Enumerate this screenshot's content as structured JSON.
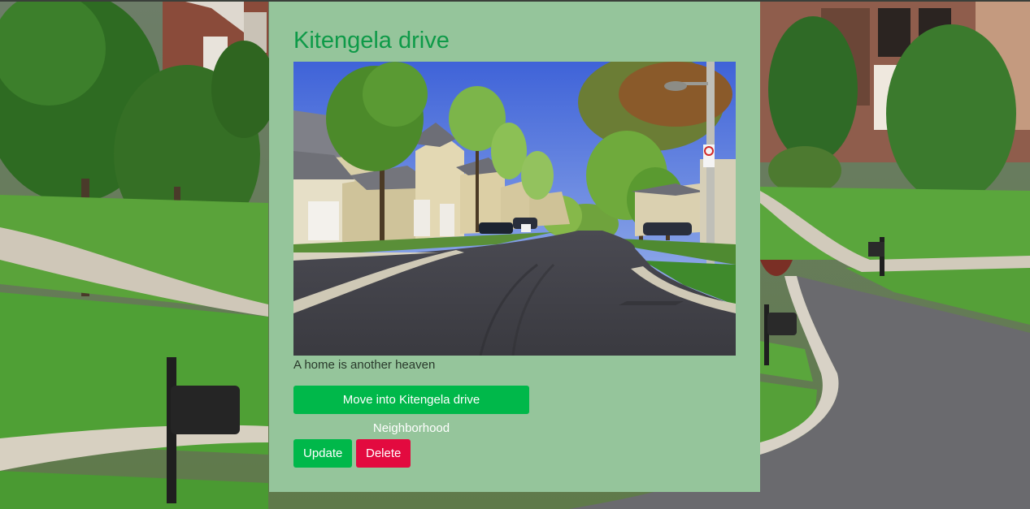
{
  "neighborhood": {
    "name": "Kitengela drive",
    "description": "A home is another heaven",
    "image_alt": "Suburban street with houses and trees"
  },
  "actions": {
    "move_label": "Move into Kitengela drive Neighborhood",
    "update_label": "Update",
    "delete_label": "Delete"
  },
  "colors": {
    "card_background": "#95c59b",
    "title": "#0e9a48",
    "primary_button": "#00b84a",
    "danger_button": "#e30a3f"
  },
  "icons": {
    "background": "suburban-street-background",
    "photo": "neighborhood-street-photo"
  }
}
